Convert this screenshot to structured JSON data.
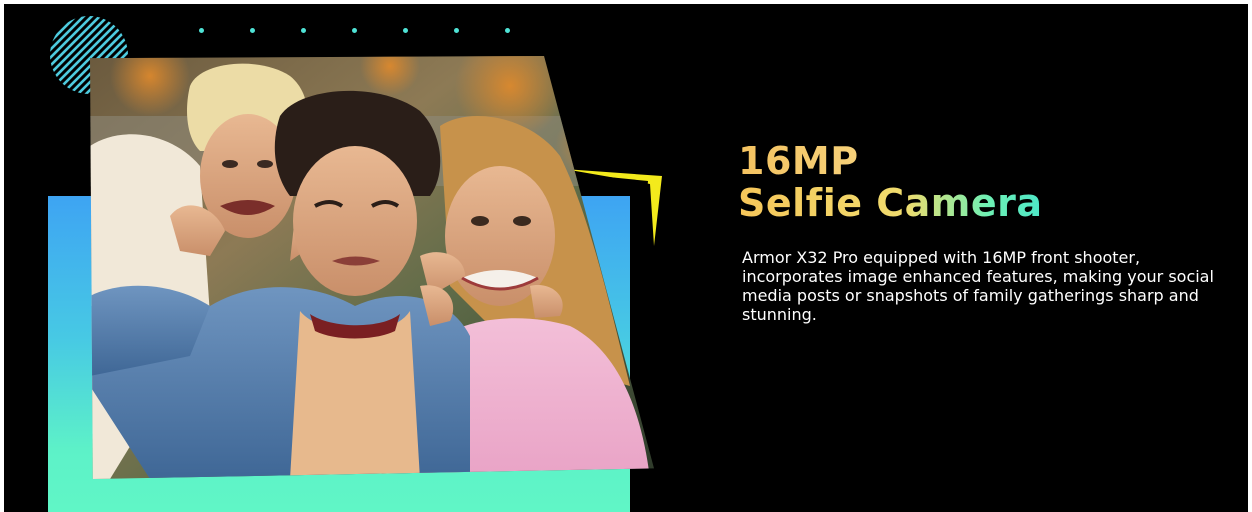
{
  "banner": {
    "headline_line_1": "16MP",
    "headline_line_2": "Selfie Camera",
    "description": "Armor X32 Pro equipped with 16MP front shooter, incorporates image enhanced features, making your social media posts or snapshots of family gatherings sharp and stunning."
  },
  "decorations": {
    "dot_count": 7,
    "dot_color": "#4fe3d6",
    "stripe_circle_colors": [
      "#3ea4f3",
      "#5df1c8"
    ],
    "accent_color": "#f3ea1c",
    "panel_gradient": [
      "#3ea4f3",
      "#60f6c6"
    ]
  },
  "photo": {
    "icon": "group-selfie-photo",
    "description_hidden": true
  },
  "colors": {
    "background": "#000000",
    "headline_gold": "#f5c760",
    "headline_mint": "#4de6c8",
    "body_text": "#ffffff"
  }
}
